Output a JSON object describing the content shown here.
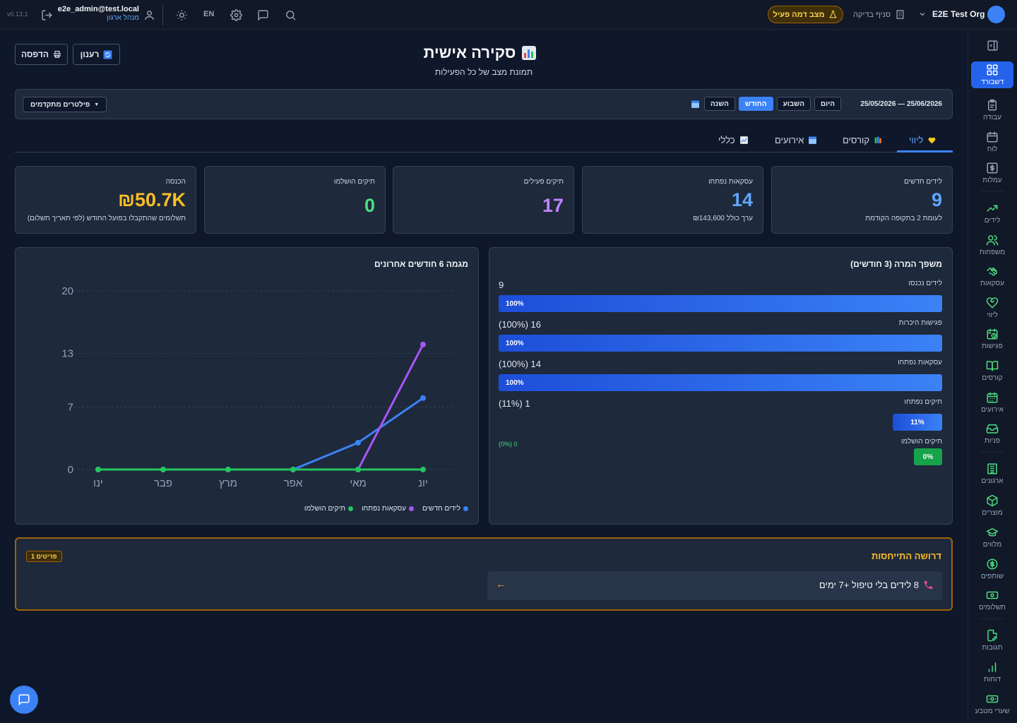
{
  "topbar": {
    "version": "v0.13.1",
    "user_email": "e2e_admin@test.local",
    "user_role": "מנהל ארגון",
    "language": "EN",
    "demo_mode": "מצב דמה פעיל",
    "branch": "סניף בדיקה",
    "org_name": "E2E Test Org"
  },
  "sidebar": {
    "items": [
      {
        "label": "דשבורד",
        "icon": "dashboard-icon"
      },
      {
        "label": "עבודה",
        "icon": "clipboard-icon"
      },
      {
        "label": "לוח",
        "icon": "calendar-icon"
      },
      {
        "label": "עמלות",
        "icon": "dollar-icon"
      },
      {
        "label": "לידים",
        "icon": "trending-up-icon"
      },
      {
        "label": "משפחות",
        "icon": "users-icon"
      },
      {
        "label": "עסקאות",
        "icon": "handshake-icon"
      },
      {
        "label": "ליווי",
        "icon": "heart-handshake-icon"
      },
      {
        "label": "פגישות",
        "icon": "calendar-clock-icon"
      },
      {
        "label": "קורסים",
        "icon": "book-icon"
      },
      {
        "label": "אירועים",
        "icon": "calendar-days-icon"
      },
      {
        "label": "פניות",
        "icon": "inbox-icon"
      },
      {
        "label": "ארגונים",
        "icon": "building-icon"
      },
      {
        "label": "מוצרים",
        "icon": "package-icon"
      },
      {
        "label": "מלווים",
        "icon": "graduation-cap-icon"
      },
      {
        "label": "שותפים",
        "icon": "coin-icon"
      },
      {
        "label": "תשלומים",
        "icon": "banknote-icon"
      },
      {
        "label": "תגובות",
        "icon": "file-edit-icon"
      },
      {
        "label": "דוחות",
        "icon": "bar-chart-icon"
      },
      {
        "label": "שערי מטבע",
        "icon": "currency-icon"
      }
    ]
  },
  "header": {
    "title": "סקירה אישית",
    "subtitle": "תמונת מצב של כל הפעילות",
    "print_label": "הדפסה",
    "refresh_label": "רענון"
  },
  "filters": {
    "periods": [
      "היום",
      "השבוע",
      "החודש",
      "השנה"
    ],
    "active_period": "החודש",
    "date_range": "25/05/2026 — 25/06/2026",
    "advanced_label": "פילטרים מתקדמים"
  },
  "tabs": [
    {
      "label": "ליווי",
      "icon": "heart-icon",
      "active": true
    },
    {
      "label": "קורסים",
      "icon": "books-icon",
      "active": false
    },
    {
      "label": "אירועים",
      "icon": "calendar-icon",
      "active": false
    },
    {
      "label": "כללי",
      "icon": "chart-icon",
      "active": false
    }
  ],
  "stats": [
    {
      "label": "לידים חדשים",
      "value": "9",
      "sub": "לעומת 2 בתקופה הקודמת",
      "color": "#60a5fa"
    },
    {
      "label": "עסקאות נפתחו",
      "value": "14",
      "sub": "₪143,600 ערך כולל",
      "color": "#60a5fa"
    },
    {
      "label": "תיקים פעילים",
      "value": "17",
      "sub": "",
      "color": "#c084fc"
    },
    {
      "label": "תיקים הושלמו",
      "value": "0",
      "sub": "",
      "color": "#4ade80"
    },
    {
      "label": "הכנסה",
      "value": "₪50.7K",
      "sub": "תשלומים שהתקבלו בפועל החודש (לפי תאריך תשלום)",
      "color": "#fbbf24"
    }
  ],
  "funnel": {
    "title": "משפך המרה (3 חודשים)",
    "rows": [
      {
        "label": "לידים נכנסו",
        "value": "9",
        "pct_label": "100%",
        "fraction": 1.0,
        "color": "blue"
      },
      {
        "label": "פגישות היכרות",
        "value": "(100%) 16",
        "pct_label": "100%",
        "fraction": 1.0,
        "color": "blue"
      },
      {
        "label": "עסקאות נפתחו",
        "value": "(100%) 14",
        "pct_label": "100%",
        "fraction": 1.0,
        "color": "blue"
      },
      {
        "label": "תיקים נפתחו",
        "value": "(11%) 1",
        "pct_label": "11%",
        "fraction": 0.11,
        "color": "blue"
      },
      {
        "label": "תיקים הושלמו",
        "value": "(0%) 0",
        "pct_label": "0%",
        "fraction": 0.0,
        "color": "green"
      }
    ]
  },
  "chart_data": {
    "type": "line",
    "title": "מגמה 6 חודשים אחרונים",
    "categories": [
      "ינו",
      "פבר",
      "מרץ",
      "אפר",
      "מאי",
      "יונ"
    ],
    "yticks": [
      "0",
      "7",
      "13",
      "20"
    ],
    "ylim": [
      0,
      20
    ],
    "series": [
      {
        "name": "לידים חדשים",
        "values": [
          0,
          0,
          0,
          0,
          3,
          8
        ],
        "color": "#3b82f6"
      },
      {
        "name": "עסקאות נפתחו",
        "values": [
          0,
          0,
          0,
          0,
          0,
          14
        ],
        "color": "#a855f7"
      },
      {
        "name": "תיקים הושלמו",
        "values": [
          0,
          0,
          0,
          0,
          0,
          0
        ],
        "color": "#22c55e"
      }
    ],
    "legend": "bottom"
  },
  "attention": {
    "title": "דרושה התייחסות",
    "badge": "1 פריטים",
    "items": [
      {
        "text": "8 לידים בלי טיפול +7 ימים",
        "icon": "phone-icon"
      }
    ]
  }
}
